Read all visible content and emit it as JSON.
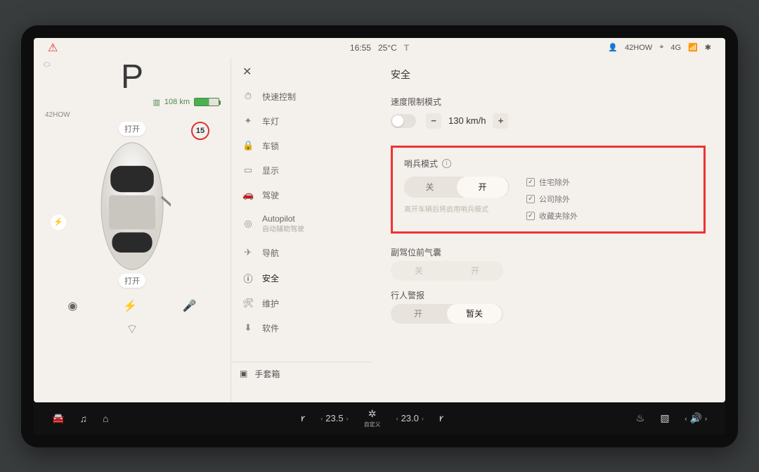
{
  "status_bar": {
    "airbag_warning_icon": "airbag-warning-icon",
    "time": "16:55",
    "temperature": "25°C",
    "tesla_logo": "T",
    "profile_name": "42HOW",
    "network_label": "4G"
  },
  "left_panel": {
    "gear": "P",
    "range_value": "108 km",
    "profile": "42HOW",
    "door_front_label": "打开",
    "door_rear_label": "打开",
    "speed_limit": "15"
  },
  "settings_nav": {
    "close": "✕",
    "items": [
      {
        "icon": "⏱",
        "label": "快速控制"
      },
      {
        "icon": "✦",
        "label": "车灯"
      },
      {
        "icon": "🔒",
        "label": "车锁"
      },
      {
        "icon": "▭",
        "label": "显示"
      },
      {
        "icon": "🚗",
        "label": "驾驶"
      },
      {
        "icon": "◎",
        "label": "Autopilot",
        "sub": "自动辅助驾驶"
      },
      {
        "icon": "✈",
        "label": "导航"
      },
      {
        "icon": "ⓘ",
        "label": "安全"
      },
      {
        "icon": "🛠",
        "label": "维护"
      },
      {
        "icon": "⬇",
        "label": "软件"
      }
    ],
    "glovebox_label": "手套箱"
  },
  "safety": {
    "title": "安全",
    "speed_limit_mode": {
      "label": "速度限制模式",
      "value": "130 km/h"
    },
    "sentry": {
      "label": "哨兵模式",
      "off": "关",
      "on": "开",
      "note": "离开车辆后将启用哨兵模式",
      "excludes": [
        "住宅除外",
        "公司除外",
        "收藏夹除外"
      ]
    },
    "passenger_airbag": {
      "label": "副驾位前气囊",
      "off": "关",
      "on": "开"
    },
    "pedestrian_warning": {
      "label": "行人警报",
      "on": "开",
      "temp_off": "暂关"
    }
  },
  "dock": {
    "left_temp": "23.5",
    "right_temp": "23.0",
    "fan_label": "自定义"
  }
}
